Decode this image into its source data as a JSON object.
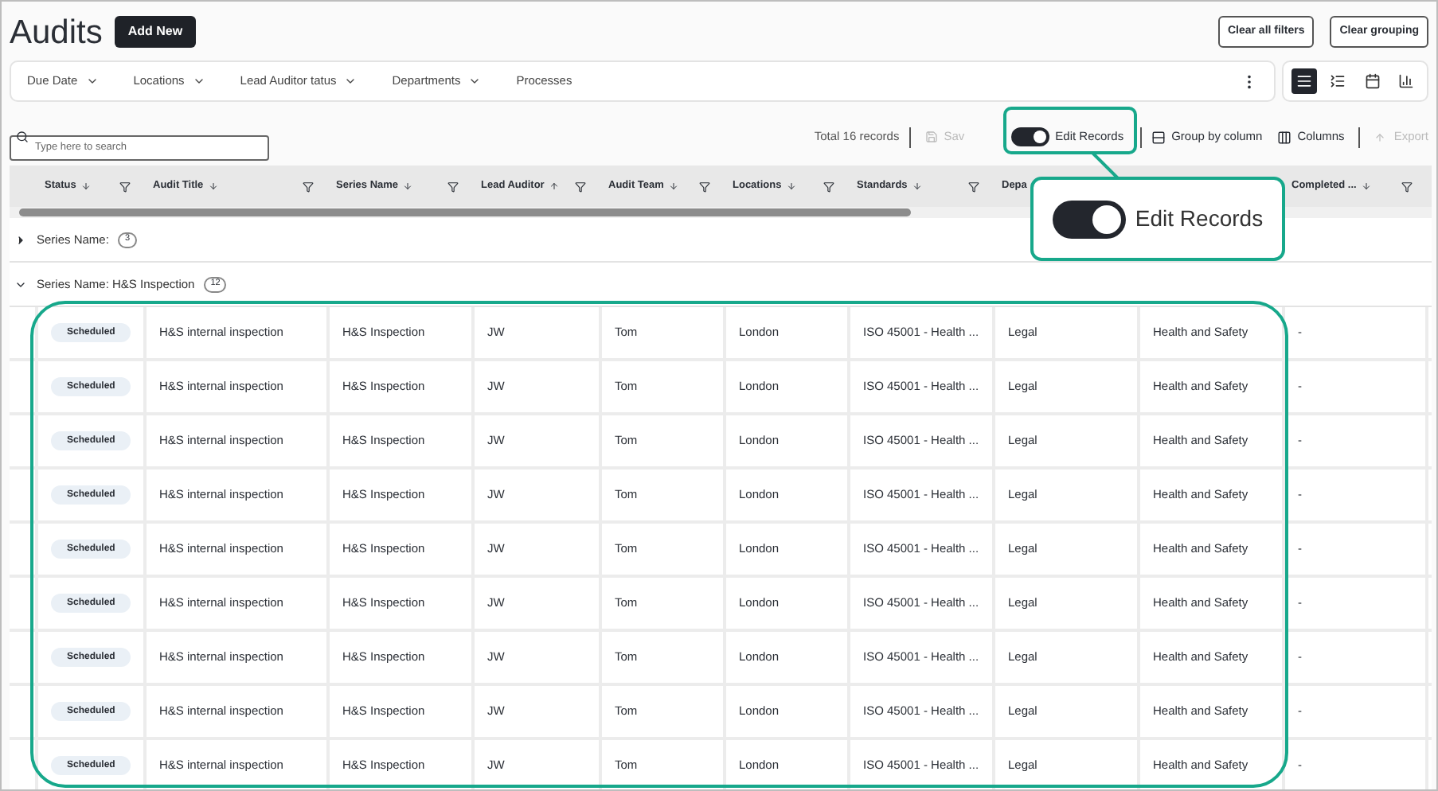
{
  "page": {
    "title": "Audits",
    "add_button": "Add New",
    "actions": [
      "Clear all filters",
      "Clear grouping"
    ]
  },
  "filters": [
    {
      "label": "Due Date",
      "dropdown": true
    },
    {
      "label": "Locations",
      "dropdown": true
    },
    {
      "label": "Lead Auditor tatus",
      "dropdown": true
    },
    {
      "label": "Departments",
      "dropdown": true
    },
    {
      "label": "Processes",
      "dropdown": false
    }
  ],
  "views": [
    {
      "kind": "list",
      "selected": true
    },
    {
      "kind": "board",
      "selected": false
    },
    {
      "kind": "calendar",
      "selected": false
    },
    {
      "kind": "chart",
      "selected": false
    }
  ],
  "search": {
    "placeholder": "Type here to search"
  },
  "toolbar": {
    "total": "Total 16 records",
    "save": {
      "label": "Sav",
      "disabled": true
    },
    "edit_toggle": {
      "label": "Edit Records",
      "on": true
    },
    "group": "Group by column",
    "columns": "Columns",
    "export": {
      "label": "Export",
      "disabled": true
    }
  },
  "table": {
    "columns": [
      {
        "label": "Status",
        "ascending": false
      },
      {
        "label": "Audit Title",
        "ascending": false
      },
      {
        "label": "Series Name",
        "ascending": false
      },
      {
        "label": "Lead Auditor",
        "ascending": true
      },
      {
        "label": "Audit Team",
        "ascending": false
      },
      {
        "label": "Locations",
        "ascending": false
      },
      {
        "label": "Standards",
        "ascending": false
      },
      {
        "label": "Depa"
      },
      {
        "covered": true
      },
      {
        "label": "Completed ...",
        "ascending": false
      }
    ],
    "groups": [
      {
        "label": "Series Name:",
        "count": "3",
        "expanded": false
      },
      {
        "label": "Series Name: H&S Inspection",
        "count": "12",
        "expanded": true
      }
    ],
    "rows": [
      {
        "status": "Scheduled",
        "audit_title": "H&S internal inspection",
        "series_name": "H&S Inspection",
        "lead_auditor": "JW",
        "audit_team": "Tom",
        "location": "London",
        "standard": "ISO 45001 - Health ...",
        "department": "Legal",
        "column_9": "Health and Safety",
        "completed": "-"
      },
      {
        "status": "Scheduled",
        "audit_title": "H&S internal inspection",
        "series_name": "H&S Inspection",
        "lead_auditor": "JW",
        "audit_team": "Tom",
        "location": "London",
        "standard": "ISO 45001 - Health ...",
        "department": "Legal",
        "column_9": "Health and Safety",
        "completed": "-"
      },
      {
        "status": "Scheduled",
        "audit_title": "H&S internal inspection",
        "series_name": "H&S Inspection",
        "lead_auditor": "JW",
        "audit_team": "Tom",
        "location": "London",
        "standard": "ISO 45001 - Health ...",
        "department": "Legal",
        "column_9": "Health and Safety",
        "completed": "-"
      },
      {
        "status": "Scheduled",
        "audit_title": "H&S internal inspection",
        "series_name": "H&S Inspection",
        "lead_auditor": "JW",
        "audit_team": "Tom",
        "location": "London",
        "standard": "ISO 45001 - Health ...",
        "department": "Legal",
        "column_9": "Health and Safety",
        "completed": "-"
      },
      {
        "status": "Scheduled",
        "audit_title": "H&S internal inspection",
        "series_name": "H&S Inspection",
        "lead_auditor": "JW",
        "audit_team": "Tom",
        "location": "London",
        "standard": "ISO 45001 - Health ...",
        "department": "Legal",
        "column_9": "Health and Safety",
        "completed": "-"
      },
      {
        "status": "Scheduled",
        "audit_title": "H&S internal inspection",
        "series_name": "H&S Inspection",
        "lead_auditor": "JW",
        "audit_team": "Tom",
        "location": "London",
        "standard": "ISO 45001 - Health ...",
        "department": "Legal",
        "column_9": "Health and Safety",
        "completed": "-"
      },
      {
        "status": "Scheduled",
        "audit_title": "H&S internal inspection",
        "series_name": "H&S Inspection",
        "lead_auditor": "JW",
        "audit_team": "Tom",
        "location": "London",
        "standard": "ISO 45001 - Health ...",
        "department": "Legal",
        "column_9": "Health and Safety",
        "completed": "-"
      },
      {
        "status": "Scheduled",
        "audit_title": "H&S internal inspection",
        "series_name": "H&S Inspection",
        "lead_auditor": "JW",
        "audit_team": "Tom",
        "location": "London",
        "standard": "ISO 45001 - Health ...",
        "department": "Legal",
        "column_9": "Health and Safety",
        "completed": "-"
      },
      {
        "status": "Scheduled",
        "audit_title": "H&S internal inspection",
        "series_name": "H&S Inspection",
        "lead_auditor": "JW",
        "audit_team": "Tom",
        "location": "London",
        "standard": "ISO 45001 - Health ...",
        "department": "Legal",
        "column_9": "Health and Safety",
        "completed": "-"
      }
    ]
  },
  "callout": {
    "label": "Edit Records",
    "on": true
  }
}
